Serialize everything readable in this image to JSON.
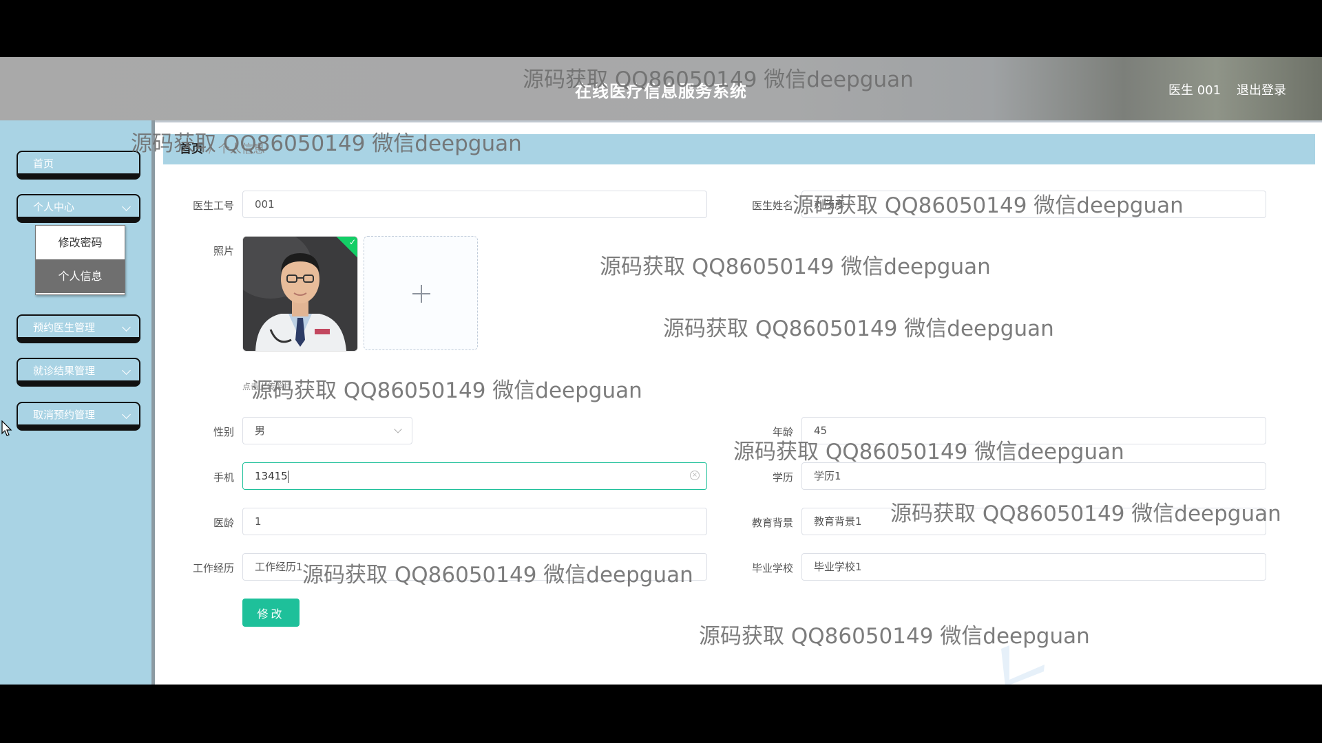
{
  "header": {
    "title": "在线医疗信息服务系统",
    "user_label": "医生 001",
    "logout_label": "退出登录"
  },
  "sidebar": {
    "items": [
      {
        "label": "首页"
      },
      {
        "label": "个人中心",
        "expanded": true,
        "children": [
          {
            "label": "修改密码"
          },
          {
            "label": "个人信息",
            "active": true
          }
        ]
      },
      {
        "label": "预约医生管理"
      },
      {
        "label": "就诊结果管理"
      },
      {
        "label": "取消预约管理"
      }
    ]
  },
  "breadcrumb": {
    "home": "首页",
    "separator": "/",
    "current": "个人信息"
  },
  "form": {
    "doctor_id": {
      "label": "医生工号",
      "value": "001"
    },
    "doctor_name": {
      "label": "医生姓名",
      "value": "刘茂彦"
    },
    "photo": {
      "label": "照片",
      "tip": "点击上传照片"
    },
    "gender": {
      "label": "性别",
      "value": "男"
    },
    "age": {
      "label": "年龄",
      "value": "45"
    },
    "phone": {
      "label": "手机",
      "value": "13415"
    },
    "education": {
      "label": "学历",
      "value": "学历1"
    },
    "years": {
      "label": "医龄",
      "value": "1"
    },
    "edu_background": {
      "label": "教育背景",
      "value": "教育背景1"
    },
    "work_history": {
      "label": "工作经历",
      "value": "工作经历1"
    },
    "school": {
      "label": "毕业学校",
      "value": "毕业学校1"
    },
    "submit_label": "修改"
  },
  "watermark": "源码获取 QQ86050149 微信deepguan",
  "colors": {
    "accent": "#1ec09a",
    "sidebar": "#a9d3e4",
    "header": "#a9a9a9"
  }
}
